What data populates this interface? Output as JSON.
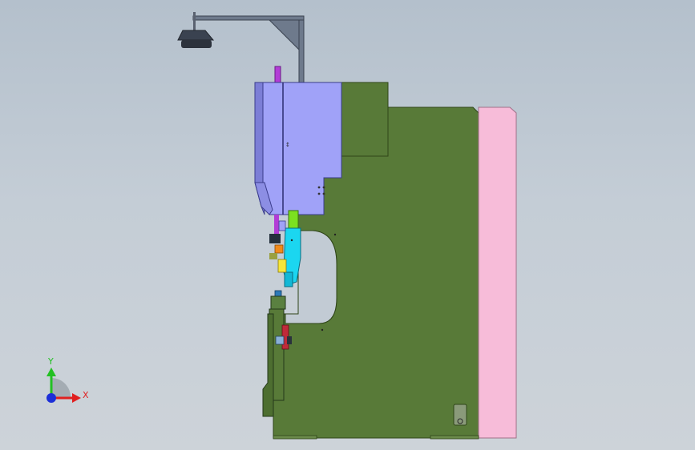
{
  "triad": {
    "x_label": "X",
    "y_label": "Y",
    "x_color": "#e02020",
    "y_color": "#22c022",
    "z_color": "#1c2fd8"
  },
  "colors": {
    "frame": "#587a38",
    "frame_dark": "#3d5a24",
    "ram": "#a0a2f8",
    "ram_side": "#7c7ed6",
    "guard": "#f7bcd9",
    "tool_cyan": "#1bd6f0",
    "tool_lime": "#7ce020",
    "pin_magenta": "#b23cd6",
    "lamp": "#3a4250",
    "arm": "#6e7a8c"
  }
}
